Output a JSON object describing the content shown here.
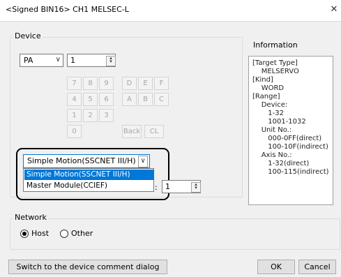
{
  "window": {
    "title": "<Signed BIN16> CH1 MELSEC-L",
    "close_icon": "close-icon"
  },
  "device": {
    "group_label": "Device",
    "type_value": "PA",
    "number_value": "1",
    "keypad": [
      "7",
      "8",
      "9",
      "D",
      "E",
      "F",
      "4",
      "5",
      "6",
      "A",
      "B",
      "C",
      "1",
      "2",
      "3",
      "0",
      "Back",
      "CL"
    ]
  },
  "module": {
    "selected": "Simple Motion(SSCNET III/H)",
    "options": [
      "Simple Motion(SSCNET III/H)",
      "Master Module(CCIEF)"
    ],
    "partial_label": ":",
    "number_value": "1"
  },
  "information": {
    "label": "Information",
    "text": "[Target Type]\n    MELSERVO\n[Kind]\n    WORD\n[Range]\n    Device:\n       1-32\n       1001-1032\n    Unit No.:\n       000-0FF(direct)\n       100-10F(indirect)\n    Axis No.:\n       1-32(direct)\n       100-115(indirect)"
  },
  "network": {
    "group_label": "Network",
    "host_label": "Host",
    "other_label": "Other",
    "selected": "Host"
  },
  "buttons": {
    "switch_label": "Switch to the device comment dialog",
    "ok_label": "OK",
    "cancel_label": "Cancel"
  }
}
